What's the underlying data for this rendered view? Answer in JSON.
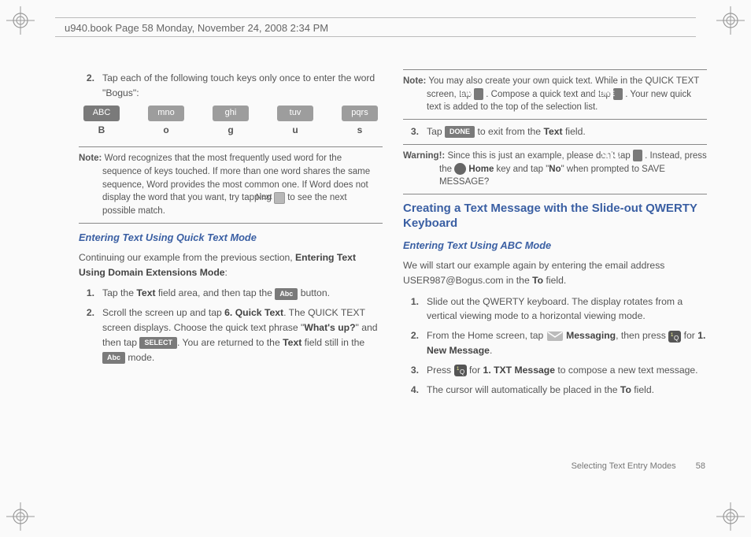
{
  "header": "u940.book  Page 58  Monday, November 24, 2008  2:34 PM",
  "left": {
    "step2num": "2.",
    "step2body": "Tap each of the following touch keys only once to enter the word \"Bogus\":",
    "keys": [
      "ABC",
      "mno",
      "ghi",
      "tuv",
      "pqrs"
    ],
    "letters": [
      "B",
      "o",
      "g",
      "u",
      "s"
    ],
    "noteLabel": "Note:",
    "noteBody_a": "Word recognizes that the most frequently used word for the sequence of keys touched. If more than one word shares the same sequence, Word provides the most common one. If Word does not display the word that you want, try tapping ",
    "noteKey": "Next",
    "noteBody_b": " to see the next possible match.",
    "h1": "Entering Text Using Quick Text Mode",
    "para_a": "Continuing our example from the previous section, ",
    "para_b": "Entering Text Using Domain Extensions Mode",
    "para_c": ":",
    "s1num": "1.",
    "s1a": "Tap the ",
    "s1b": "Text",
    "s1c": " field area, and then tap the ",
    "s1key": "Abc",
    "s1d": " button.",
    "s2num": "2.",
    "s2a": "Scroll the screen up and tap ",
    "s2b": "6. Quick Text",
    "s2c": ". The QUICK TEXT screen displays. Choose the quick text phrase \"",
    "s2d": "What's up?",
    "s2e": "\" and then tap ",
    "s2key": "SELECT",
    "s2f": ". You are returned to the ",
    "s2g": "Text",
    "s2h": " field still in the ",
    "s2key2": "Abc",
    "s2i": " mode."
  },
  "right": {
    "noteLabel": "Note:",
    "n1a": "You may also create your own quick text. While in the QUICK TEXT screen, tap ",
    "n1key1": "NEW",
    "n1b": ". Compose a quick text and tap ",
    "n1key2": "DONE",
    "n1c": ". Your new quick text is added to the top of the selection list.",
    "s3num": "3.",
    "s3a": "Tap ",
    "s3key": "DONE",
    "s3b": " to exit from the ",
    "s3c": "Text",
    "s3d": " field.",
    "warnLabel": "Warning!:",
    "w1a": "Since this is just an example, please don't tap ",
    "w1key": "SEND",
    "w1b": ". Instead, press the ",
    "w1c": " Home",
    "w1d": " key and tap \"",
    "w1e": "No",
    "w1f": "\" when prompted to SAVE MESSAGE?",
    "h2": "Creating a Text Message with the Slide-out QWERTY Keyboard",
    "h3": "Entering Text Using ABC Mode",
    "p2a": "We will start our example again by entering the email address USER987@Bogus.com in the ",
    "p2b": "To",
    "p2c": " field.",
    "q1num": "1.",
    "q1": "Slide out the QWERTY keyboard. The display rotates from a vertical viewing mode to a horizontal viewing mode.",
    "q2num": "2.",
    "q2a": "From the Home screen, tap ",
    "q2b": " Messaging",
    "q2c": ", then press ",
    "q2d": " for ",
    "q2e": "1. New Message",
    "q2f": ".",
    "q3num": "3.",
    "q3a": "Press ",
    "q3b": " for ",
    "q3c": "1. TXT Message",
    "q3d": " to compose a new text message.",
    "q4num": "4.",
    "q4a": "The cursor will automatically be placed in the ",
    "q4b": "To",
    "q4c": " field."
  },
  "footer": {
    "section": "Selecting Text Entry Modes",
    "page": "58"
  }
}
